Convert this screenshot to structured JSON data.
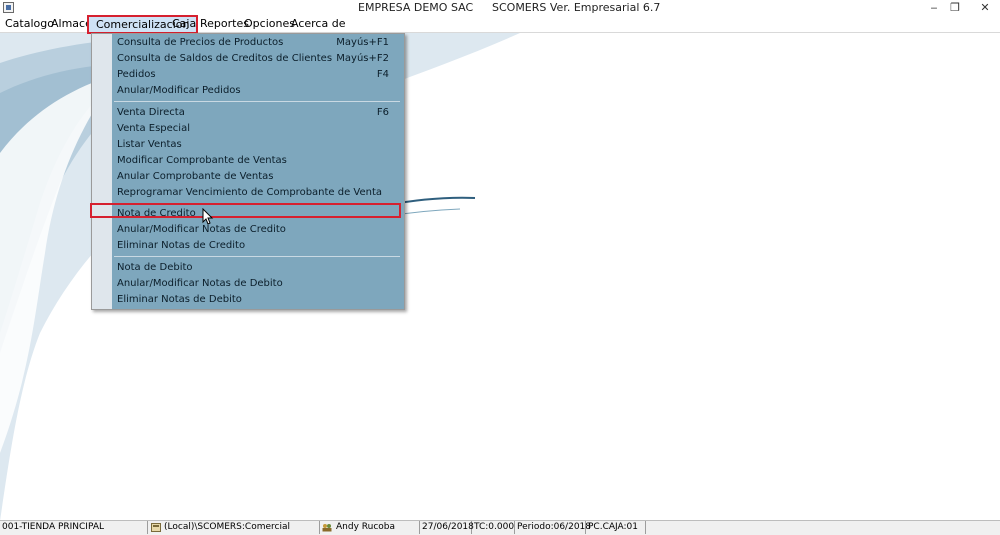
{
  "window": {
    "title_company": "EMPRESA DEMO SAC",
    "title_version": "SCOMERS Ver. Empresarial  6.7",
    "controls": {
      "minimize": "‒",
      "restore": "❐",
      "close": "✕"
    }
  },
  "menubar": {
    "items": [
      {
        "label": "Catalogo"
      },
      {
        "label": "Almacen"
      },
      {
        "label": "Comercializacion"
      },
      {
        "label": "Caja"
      },
      {
        "label": "Reportes"
      },
      {
        "label": "Opciones"
      },
      {
        "label": "Acerca de"
      }
    ],
    "active": "Comercializacion"
  },
  "dropdown": {
    "items": [
      {
        "label": "Consulta de Precios de Productos",
        "shortcut": "Mayús+F1"
      },
      {
        "label": "Consulta de Saldos de Creditos de Clientes",
        "shortcut": "Mayús+F2"
      },
      {
        "label": "Pedidos",
        "shortcut": "F4"
      },
      {
        "label": "Anular/Modificar Pedidos",
        "shortcut": ""
      },
      {
        "label": "Venta Directa",
        "shortcut": "F6"
      },
      {
        "label": "Venta Especial",
        "shortcut": ""
      },
      {
        "label": "Listar Ventas",
        "shortcut": ""
      },
      {
        "label": "Modificar Comprobante de Ventas",
        "shortcut": ""
      },
      {
        "label": "Anular Comprobante de Ventas",
        "shortcut": ""
      },
      {
        "label": "Reprogramar Vencimiento de Comprobante de Venta",
        "shortcut": ""
      },
      {
        "label": "Nota de Credito",
        "shortcut": ""
      },
      {
        "label": "Anular/Modificar Notas de Credito",
        "shortcut": ""
      },
      {
        "label": "Eliminar Notas de Credito",
        "shortcut": ""
      },
      {
        "label": "Nota de Debito",
        "shortcut": ""
      },
      {
        "label": "Anular/Modificar Notas de Debito",
        "shortcut": ""
      },
      {
        "label": "Eliminar Notas de Debito",
        "shortcut": ""
      }
    ],
    "highlighted": "Nota de Credito"
  },
  "statusbar": {
    "store": "001-TIENDA PRINCIPAL",
    "database": "(Local)\\SCOMERS:Comercial",
    "user": "Andy Rucoba",
    "date": "27/06/2018",
    "tc": "TC:0.000",
    "period": "Periodo:06/2018",
    "pc": "PC.CAJA:01"
  },
  "colors": {
    "menu_bg": "#7ea7bd",
    "highlight_border": "#d6202f",
    "decoration_blue": "#c5d8e6",
    "decoration_dark": "#2f5f7e"
  }
}
